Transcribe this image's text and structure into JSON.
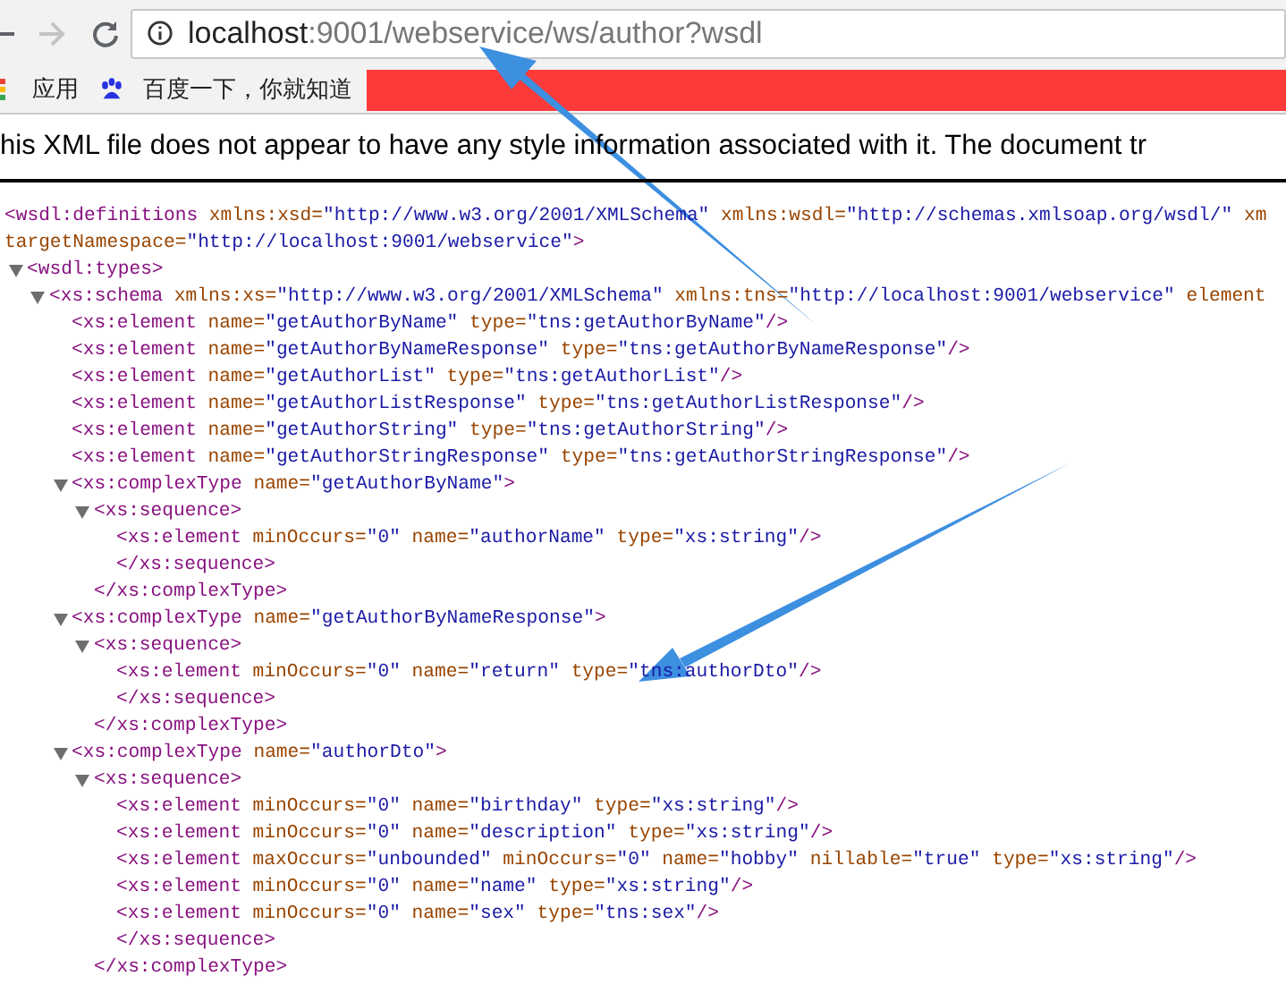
{
  "toolbar": {
    "url_host": "localhost",
    "url_rest": ":9001/webservice/ws/author?wsdl"
  },
  "bookmarks": [
    {
      "kind": "apps",
      "label": "应用"
    },
    {
      "kind": "baidu",
      "label": "百度一下，你就知道"
    },
    {
      "kind": "redacted"
    }
  ],
  "notice": "his XML file does not appear to have any style information associated with it. The document tr",
  "xml": [
    {
      "open": [
        [
          {
            "kind": "tag",
            "text": "<wsdl:definitions"
          },
          {
            "kind": "attr",
            "text": " xmlns:xsd="
          },
          {
            "kind": "value",
            "text": "\"http://www.w3.org/2001/XMLSchema\""
          },
          {
            "kind": "attr",
            "text": " xmlns:wsdl="
          },
          {
            "kind": "value",
            "text": "\"http://schemas.xmlsoap.org/wsdl/\""
          },
          {
            "kind": "attr",
            "text": " xm"
          }
        ],
        [
          {
            "kind": "attr",
            "text": "targetNamespace="
          },
          {
            "kind": "value",
            "text": "\"http://localhost:9001/webservice\""
          },
          {
            "kind": "tag",
            "text": ">"
          }
        ]
      ],
      "children": [
        {
          "expanded": true,
          "open": [
            [
              {
                "kind": "tag",
                "text": "<wsdl:types>"
              }
            ]
          ],
          "children": [
            {
              "expanded": true,
              "open": [
                [
                  {
                    "kind": "tag",
                    "text": "<xs:schema"
                  },
                  {
                    "kind": "attr",
                    "text": " xmlns:xs="
                  },
                  {
                    "kind": "value",
                    "text": "\"http://www.w3.org/2001/XMLSchema\""
                  },
                  {
                    "kind": "attr",
                    "text": " xmlns:tns="
                  },
                  {
                    "kind": "value",
                    "text": "\"http://localhost:9001/webservice\""
                  },
                  {
                    "kind": "attr",
                    "text": " element"
                  }
                ]
              ],
              "children": [
                {
                  "open": [
                    [
                      {
                        "kind": "tag",
                        "text": "<xs:element"
                      },
                      {
                        "kind": "attr",
                        "text": " name="
                      },
                      {
                        "kind": "value",
                        "text": "\"getAuthorByName\""
                      },
                      {
                        "kind": "attr",
                        "text": " type="
                      },
                      {
                        "kind": "value",
                        "text": "\"tns:getAuthorByName\""
                      },
                      {
                        "kind": "tag",
                        "text": "/>"
                      }
                    ]
                  ]
                },
                {
                  "open": [
                    [
                      {
                        "kind": "tag",
                        "text": "<xs:element"
                      },
                      {
                        "kind": "attr",
                        "text": " name="
                      },
                      {
                        "kind": "value",
                        "text": "\"getAuthorByNameResponse\""
                      },
                      {
                        "kind": "attr",
                        "text": " type="
                      },
                      {
                        "kind": "value",
                        "text": "\"tns:getAuthorByNameResponse\""
                      },
                      {
                        "kind": "tag",
                        "text": "/>"
                      }
                    ]
                  ]
                },
                {
                  "open": [
                    [
                      {
                        "kind": "tag",
                        "text": "<xs:element"
                      },
                      {
                        "kind": "attr",
                        "text": " name="
                      },
                      {
                        "kind": "value",
                        "text": "\"getAuthorList\""
                      },
                      {
                        "kind": "attr",
                        "text": " type="
                      },
                      {
                        "kind": "value",
                        "text": "\"tns:getAuthorList\""
                      },
                      {
                        "kind": "tag",
                        "text": "/>"
                      }
                    ]
                  ]
                },
                {
                  "open": [
                    [
                      {
                        "kind": "tag",
                        "text": "<xs:element"
                      },
                      {
                        "kind": "attr",
                        "text": " name="
                      },
                      {
                        "kind": "value",
                        "text": "\"getAuthorListResponse\""
                      },
                      {
                        "kind": "attr",
                        "text": " type="
                      },
                      {
                        "kind": "value",
                        "text": "\"tns:getAuthorListResponse\""
                      },
                      {
                        "kind": "tag",
                        "text": "/>"
                      }
                    ]
                  ]
                },
                {
                  "open": [
                    [
                      {
                        "kind": "tag",
                        "text": "<xs:element"
                      },
                      {
                        "kind": "attr",
                        "text": " name="
                      },
                      {
                        "kind": "value",
                        "text": "\"getAuthorString\""
                      },
                      {
                        "kind": "attr",
                        "text": " type="
                      },
                      {
                        "kind": "value",
                        "text": "\"tns:getAuthorString\""
                      },
                      {
                        "kind": "tag",
                        "text": "/>"
                      }
                    ]
                  ]
                },
                {
                  "open": [
                    [
                      {
                        "kind": "tag",
                        "text": "<xs:element"
                      },
                      {
                        "kind": "attr",
                        "text": " name="
                      },
                      {
                        "kind": "value",
                        "text": "\"getAuthorStringResponse\""
                      },
                      {
                        "kind": "attr",
                        "text": " type="
                      },
                      {
                        "kind": "value",
                        "text": "\"tns:getAuthorStringResponse\""
                      },
                      {
                        "kind": "tag",
                        "text": "/>"
                      }
                    ]
                  ]
                },
                {
                  "expanded": true,
                  "open": [
                    [
                      {
                        "kind": "tag",
                        "text": "<xs:complexType"
                      },
                      {
                        "kind": "attr",
                        "text": " name="
                      },
                      {
                        "kind": "value",
                        "text": "\"getAuthorByName\""
                      },
                      {
                        "kind": "tag",
                        "text": ">"
                      }
                    ]
                  ],
                  "close": [
                    {
                      "kind": "tag",
                      "text": "</xs:complexType>"
                    }
                  ],
                  "children": [
                    {
                      "expanded": true,
                      "open": [
                        [
                          {
                            "kind": "tag",
                            "text": "<xs:sequence>"
                          }
                        ]
                      ],
                      "close": [
                        {
                          "kind": "tag",
                          "text": "</xs:sequence>"
                        }
                      ],
                      "children": [
                        {
                          "open": [
                            [
                              {
                                "kind": "tag",
                                "text": "<xs:element"
                              },
                              {
                                "kind": "attr",
                                "text": " minOccurs="
                              },
                              {
                                "kind": "value",
                                "text": "\"0\""
                              },
                              {
                                "kind": "attr",
                                "text": " name="
                              },
                              {
                                "kind": "value",
                                "text": "\"authorName\""
                              },
                              {
                                "kind": "attr",
                                "text": " type="
                              },
                              {
                                "kind": "value",
                                "text": "\"xs:string\""
                              },
                              {
                                "kind": "tag",
                                "text": "/>"
                              }
                            ]
                          ]
                        }
                      ]
                    }
                  ]
                },
                {
                  "expanded": true,
                  "open": [
                    [
                      {
                        "kind": "tag",
                        "text": "<xs:complexType"
                      },
                      {
                        "kind": "attr",
                        "text": " name="
                      },
                      {
                        "kind": "value",
                        "text": "\"getAuthorByNameResponse\""
                      },
                      {
                        "kind": "tag",
                        "text": ">"
                      }
                    ]
                  ],
                  "close": [
                    {
                      "kind": "tag",
                      "text": "</xs:complexType>"
                    }
                  ],
                  "children": [
                    {
                      "expanded": true,
                      "open": [
                        [
                          {
                            "kind": "tag",
                            "text": "<xs:sequence>"
                          }
                        ]
                      ],
                      "close": [
                        {
                          "kind": "tag",
                          "text": "</xs:sequence>"
                        }
                      ],
                      "children": [
                        {
                          "open": [
                            [
                              {
                                "kind": "tag",
                                "text": "<xs:element"
                              },
                              {
                                "kind": "attr",
                                "text": " minOccurs="
                              },
                              {
                                "kind": "value",
                                "text": "\"0\""
                              },
                              {
                                "kind": "attr",
                                "text": " name="
                              },
                              {
                                "kind": "value",
                                "text": "\"return\""
                              },
                              {
                                "kind": "attr",
                                "text": " type="
                              },
                              {
                                "kind": "value",
                                "text": "\"tns:authorDto\""
                              },
                              {
                                "kind": "tag",
                                "text": "/>"
                              }
                            ]
                          ]
                        }
                      ]
                    }
                  ]
                },
                {
                  "expanded": true,
                  "open": [
                    [
                      {
                        "kind": "tag",
                        "text": "<xs:complexType"
                      },
                      {
                        "kind": "attr",
                        "text": " name="
                      },
                      {
                        "kind": "value",
                        "text": "\"authorDto\""
                      },
                      {
                        "kind": "tag",
                        "text": ">"
                      }
                    ]
                  ],
                  "close": [
                    {
                      "kind": "tag",
                      "text": "</xs:complexType>"
                    }
                  ],
                  "children": [
                    {
                      "expanded": true,
                      "open": [
                        [
                          {
                            "kind": "tag",
                            "text": "<xs:sequence>"
                          }
                        ]
                      ],
                      "close": [
                        {
                          "kind": "tag",
                          "text": "</xs:sequence>"
                        }
                      ],
                      "children": [
                        {
                          "open": [
                            [
                              {
                                "kind": "tag",
                                "text": "<xs:element"
                              },
                              {
                                "kind": "attr",
                                "text": " minOccurs="
                              },
                              {
                                "kind": "value",
                                "text": "\"0\""
                              },
                              {
                                "kind": "attr",
                                "text": " name="
                              },
                              {
                                "kind": "value",
                                "text": "\"birthday\""
                              },
                              {
                                "kind": "attr",
                                "text": " type="
                              },
                              {
                                "kind": "value",
                                "text": "\"xs:string\""
                              },
                              {
                                "kind": "tag",
                                "text": "/>"
                              }
                            ]
                          ]
                        },
                        {
                          "open": [
                            [
                              {
                                "kind": "tag",
                                "text": "<xs:element"
                              },
                              {
                                "kind": "attr",
                                "text": " minOccurs="
                              },
                              {
                                "kind": "value",
                                "text": "\"0\""
                              },
                              {
                                "kind": "attr",
                                "text": " name="
                              },
                              {
                                "kind": "value",
                                "text": "\"description\""
                              },
                              {
                                "kind": "attr",
                                "text": " type="
                              },
                              {
                                "kind": "value",
                                "text": "\"xs:string\""
                              },
                              {
                                "kind": "tag",
                                "text": "/>"
                              }
                            ]
                          ]
                        },
                        {
                          "open": [
                            [
                              {
                                "kind": "tag",
                                "text": "<xs:element"
                              },
                              {
                                "kind": "attr",
                                "text": " maxOccurs="
                              },
                              {
                                "kind": "value",
                                "text": "\"unbounded\""
                              },
                              {
                                "kind": "attr",
                                "text": " minOccurs="
                              },
                              {
                                "kind": "value",
                                "text": "\"0\""
                              },
                              {
                                "kind": "attr",
                                "text": " name="
                              },
                              {
                                "kind": "value",
                                "text": "\"hobby\""
                              },
                              {
                                "kind": "attr",
                                "text": " nillable="
                              },
                              {
                                "kind": "value",
                                "text": "\"true\""
                              },
                              {
                                "kind": "attr",
                                "text": " type="
                              },
                              {
                                "kind": "value",
                                "text": "\"xs:string\""
                              },
                              {
                                "kind": "tag",
                                "text": "/>"
                              }
                            ]
                          ]
                        },
                        {
                          "open": [
                            [
                              {
                                "kind": "tag",
                                "text": "<xs:element"
                              },
                              {
                                "kind": "attr",
                                "text": " minOccurs="
                              },
                              {
                                "kind": "value",
                                "text": "\"0\""
                              },
                              {
                                "kind": "attr",
                                "text": " name="
                              },
                              {
                                "kind": "value",
                                "text": "\"name\""
                              },
                              {
                                "kind": "attr",
                                "text": " type="
                              },
                              {
                                "kind": "value",
                                "text": "\"xs:string\""
                              },
                              {
                                "kind": "tag",
                                "text": "/>"
                              }
                            ]
                          ]
                        },
                        {
                          "open": [
                            [
                              {
                                "kind": "tag",
                                "text": "<xs:element"
                              },
                              {
                                "kind": "attr",
                                "text": " minOccurs="
                              },
                              {
                                "kind": "value",
                                "text": "\"0\""
                              },
                              {
                                "kind": "attr",
                                "text": " name="
                              },
                              {
                                "kind": "value",
                                "text": "\"sex\""
                              },
                              {
                                "kind": "attr",
                                "text": " type="
                              },
                              {
                                "kind": "value",
                                "text": "\"tns:sex\""
                              },
                              {
                                "kind": "tag",
                                "text": "/>"
                              }
                            ]
                          ]
                        }
                      ]
                    }
                  ]
                }
              ]
            }
          ]
        }
      ]
    }
  ]
}
